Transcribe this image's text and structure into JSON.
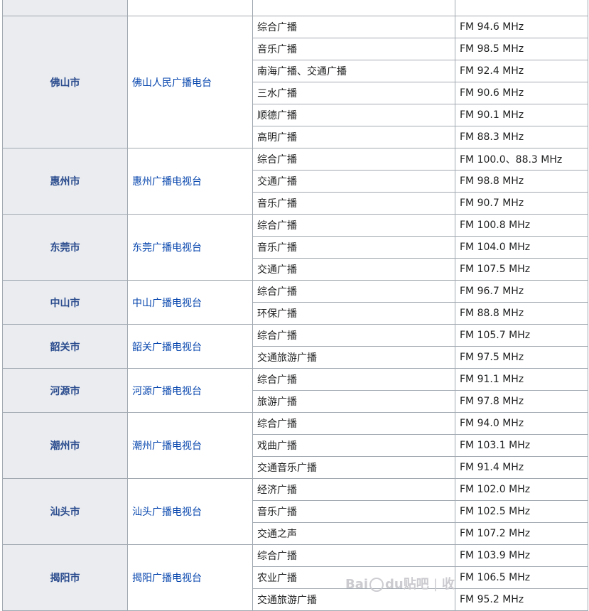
{
  "rows": [
    {
      "city": "",
      "station": "",
      "channel": "",
      "freq": ""
    },
    {
      "city": "佛山市",
      "station": "佛山人民广播电台",
      "channel": "综合广播",
      "freq": "FM 94.6 MHz"
    },
    {
      "channel": "音乐广播",
      "freq": "FM 98.5 MHz"
    },
    {
      "channel": "南海广播、交通广播",
      "freq": "FM 92.4 MHz"
    },
    {
      "channel": "三水广播",
      "freq": "FM 90.6 MHz"
    },
    {
      "channel": "顺德广播",
      "freq": "FM 90.1 MHz"
    },
    {
      "channel": "高明广播",
      "freq": "FM 88.3 MHz"
    },
    {
      "city": "惠州市",
      "station": "惠州广播电视台",
      "channel": "综合广播",
      "freq": "FM 100.0、88.3 MHz"
    },
    {
      "channel": "交通广播",
      "freq": "FM 98.8 MHz"
    },
    {
      "channel": "音乐广播",
      "freq": "FM 90.7 MHz"
    },
    {
      "city": "东莞市",
      "station": "东莞广播电视台",
      "channel": "综合广播",
      "freq": "FM 100.8 MHz"
    },
    {
      "channel": "音乐广播",
      "freq": "FM 104.0 MHz"
    },
    {
      "channel": "交通广播",
      "freq": "FM 107.5 MHz"
    },
    {
      "city": "中山市",
      "station": "中山广播电视台",
      "channel": "综合广播",
      "freq": "FM 96.7 MHz"
    },
    {
      "channel": "环保广播",
      "freq": "FM 88.8 MHz"
    },
    {
      "city": "韶关市",
      "station": "韶关广播电视台",
      "channel": "综合广播",
      "freq": "FM 105.7 MHz"
    },
    {
      "channel": "交通旅游广播",
      "freq": "FM 97.5 MHz"
    },
    {
      "city": "河源市",
      "station": "河源广播电视台",
      "channel": "综合广播",
      "freq": "FM 91.1 MHz"
    },
    {
      "channel": "旅游广播",
      "freq": "FM 97.8 MHz"
    },
    {
      "city": "潮州市",
      "station": "潮州广播电视台",
      "channel": "综合广播",
      "freq": "FM 94.0 MHz"
    },
    {
      "channel": "戏曲广播",
      "freq": "FM 103.1 MHz"
    },
    {
      "channel": "交通音乐广播",
      "freq": "FM 91.4 MHz"
    },
    {
      "city": "汕头市",
      "station": "汕头广播电视台",
      "channel": "经济广播",
      "freq": "FM 102.0 MHz"
    },
    {
      "channel": "音乐广播",
      "freq": "FM 102.5 MHz"
    },
    {
      "channel": "交通之声",
      "freq": "FM 107.2 MHz"
    },
    {
      "city": "揭阳市",
      "station": "揭阳广播电视台",
      "channel": "综合广播",
      "freq": "FM 103.9 MHz"
    },
    {
      "channel": "农业广播",
      "freq": "FM 106.5 MHz"
    },
    {
      "channel": "交通旅游广播",
      "freq": "FM 95.2 MHz"
    }
  ],
  "groups": [
    {
      "start": 0,
      "span": 1
    },
    {
      "start": 1,
      "span": 6
    },
    {
      "start": 7,
      "span": 3
    },
    {
      "start": 10,
      "span": 3
    },
    {
      "start": 13,
      "span": 2
    },
    {
      "start": 15,
      "span": 2
    },
    {
      "start": 17,
      "span": 2
    },
    {
      "start": 19,
      "span": 3
    },
    {
      "start": 22,
      "span": 3
    },
    {
      "start": 25,
      "span": 3
    }
  ],
  "watermark": {
    "logo_text": "Bai",
    "logo_suffix": "du",
    "product": "贴吧",
    "separator": "|",
    "extra": "收"
  }
}
